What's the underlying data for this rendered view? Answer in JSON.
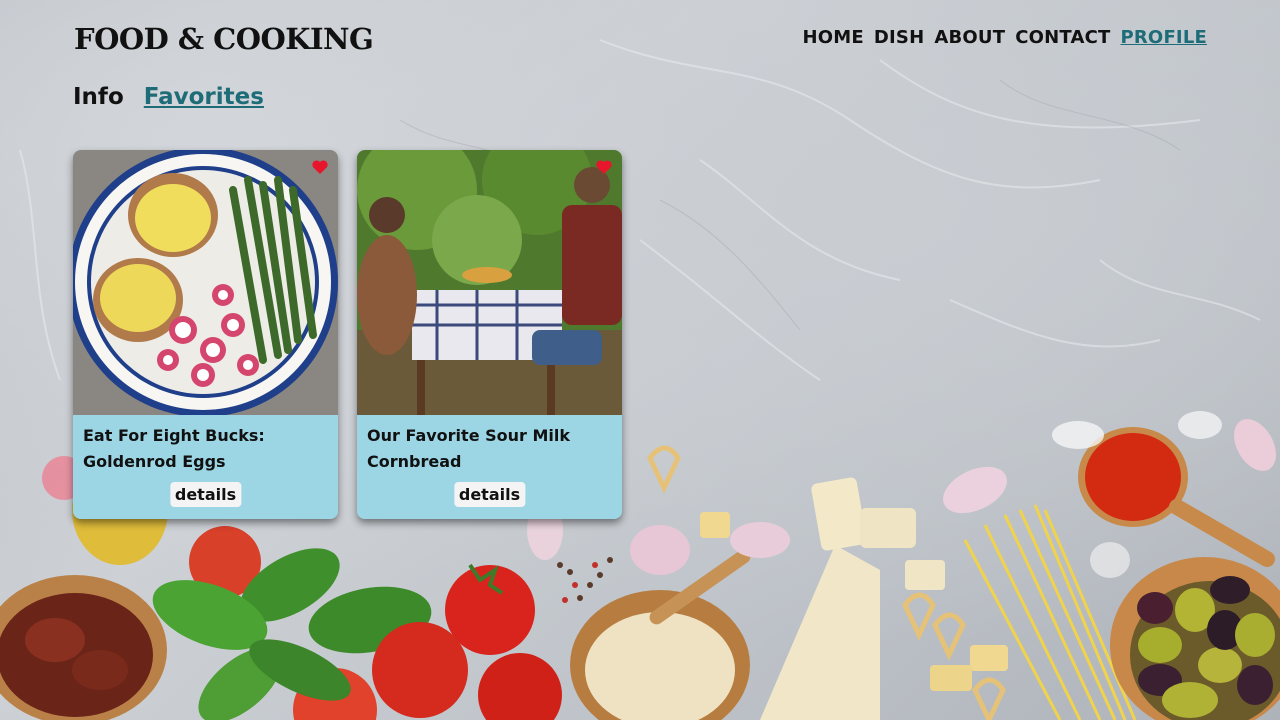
{
  "header": {
    "logo": "FOOD & COOKING",
    "nav": [
      {
        "label": "HOME"
      },
      {
        "label": "DISH"
      },
      {
        "label": "ABOUT"
      },
      {
        "label": "CONTACT"
      },
      {
        "label": "PROFILE",
        "active": true
      }
    ]
  },
  "tabs": [
    {
      "label": "Info"
    },
    {
      "label": "Favorites",
      "active": true
    }
  ],
  "cards": [
    {
      "title_line1": "Eat For Eight Bucks:",
      "title_line2": "Goldenrod Eggs",
      "button": "details",
      "favorite": true
    },
    {
      "title_line1": "Our Favorite Sour Milk",
      "title_line2": "Cornbread",
      "button": "details",
      "favorite": true
    }
  ],
  "colors": {
    "accent": "#1d6c78",
    "heart": "#e8162c",
    "card_info_bg": "#9bd6e6"
  },
  "icons": [
    "heart-icon"
  ]
}
